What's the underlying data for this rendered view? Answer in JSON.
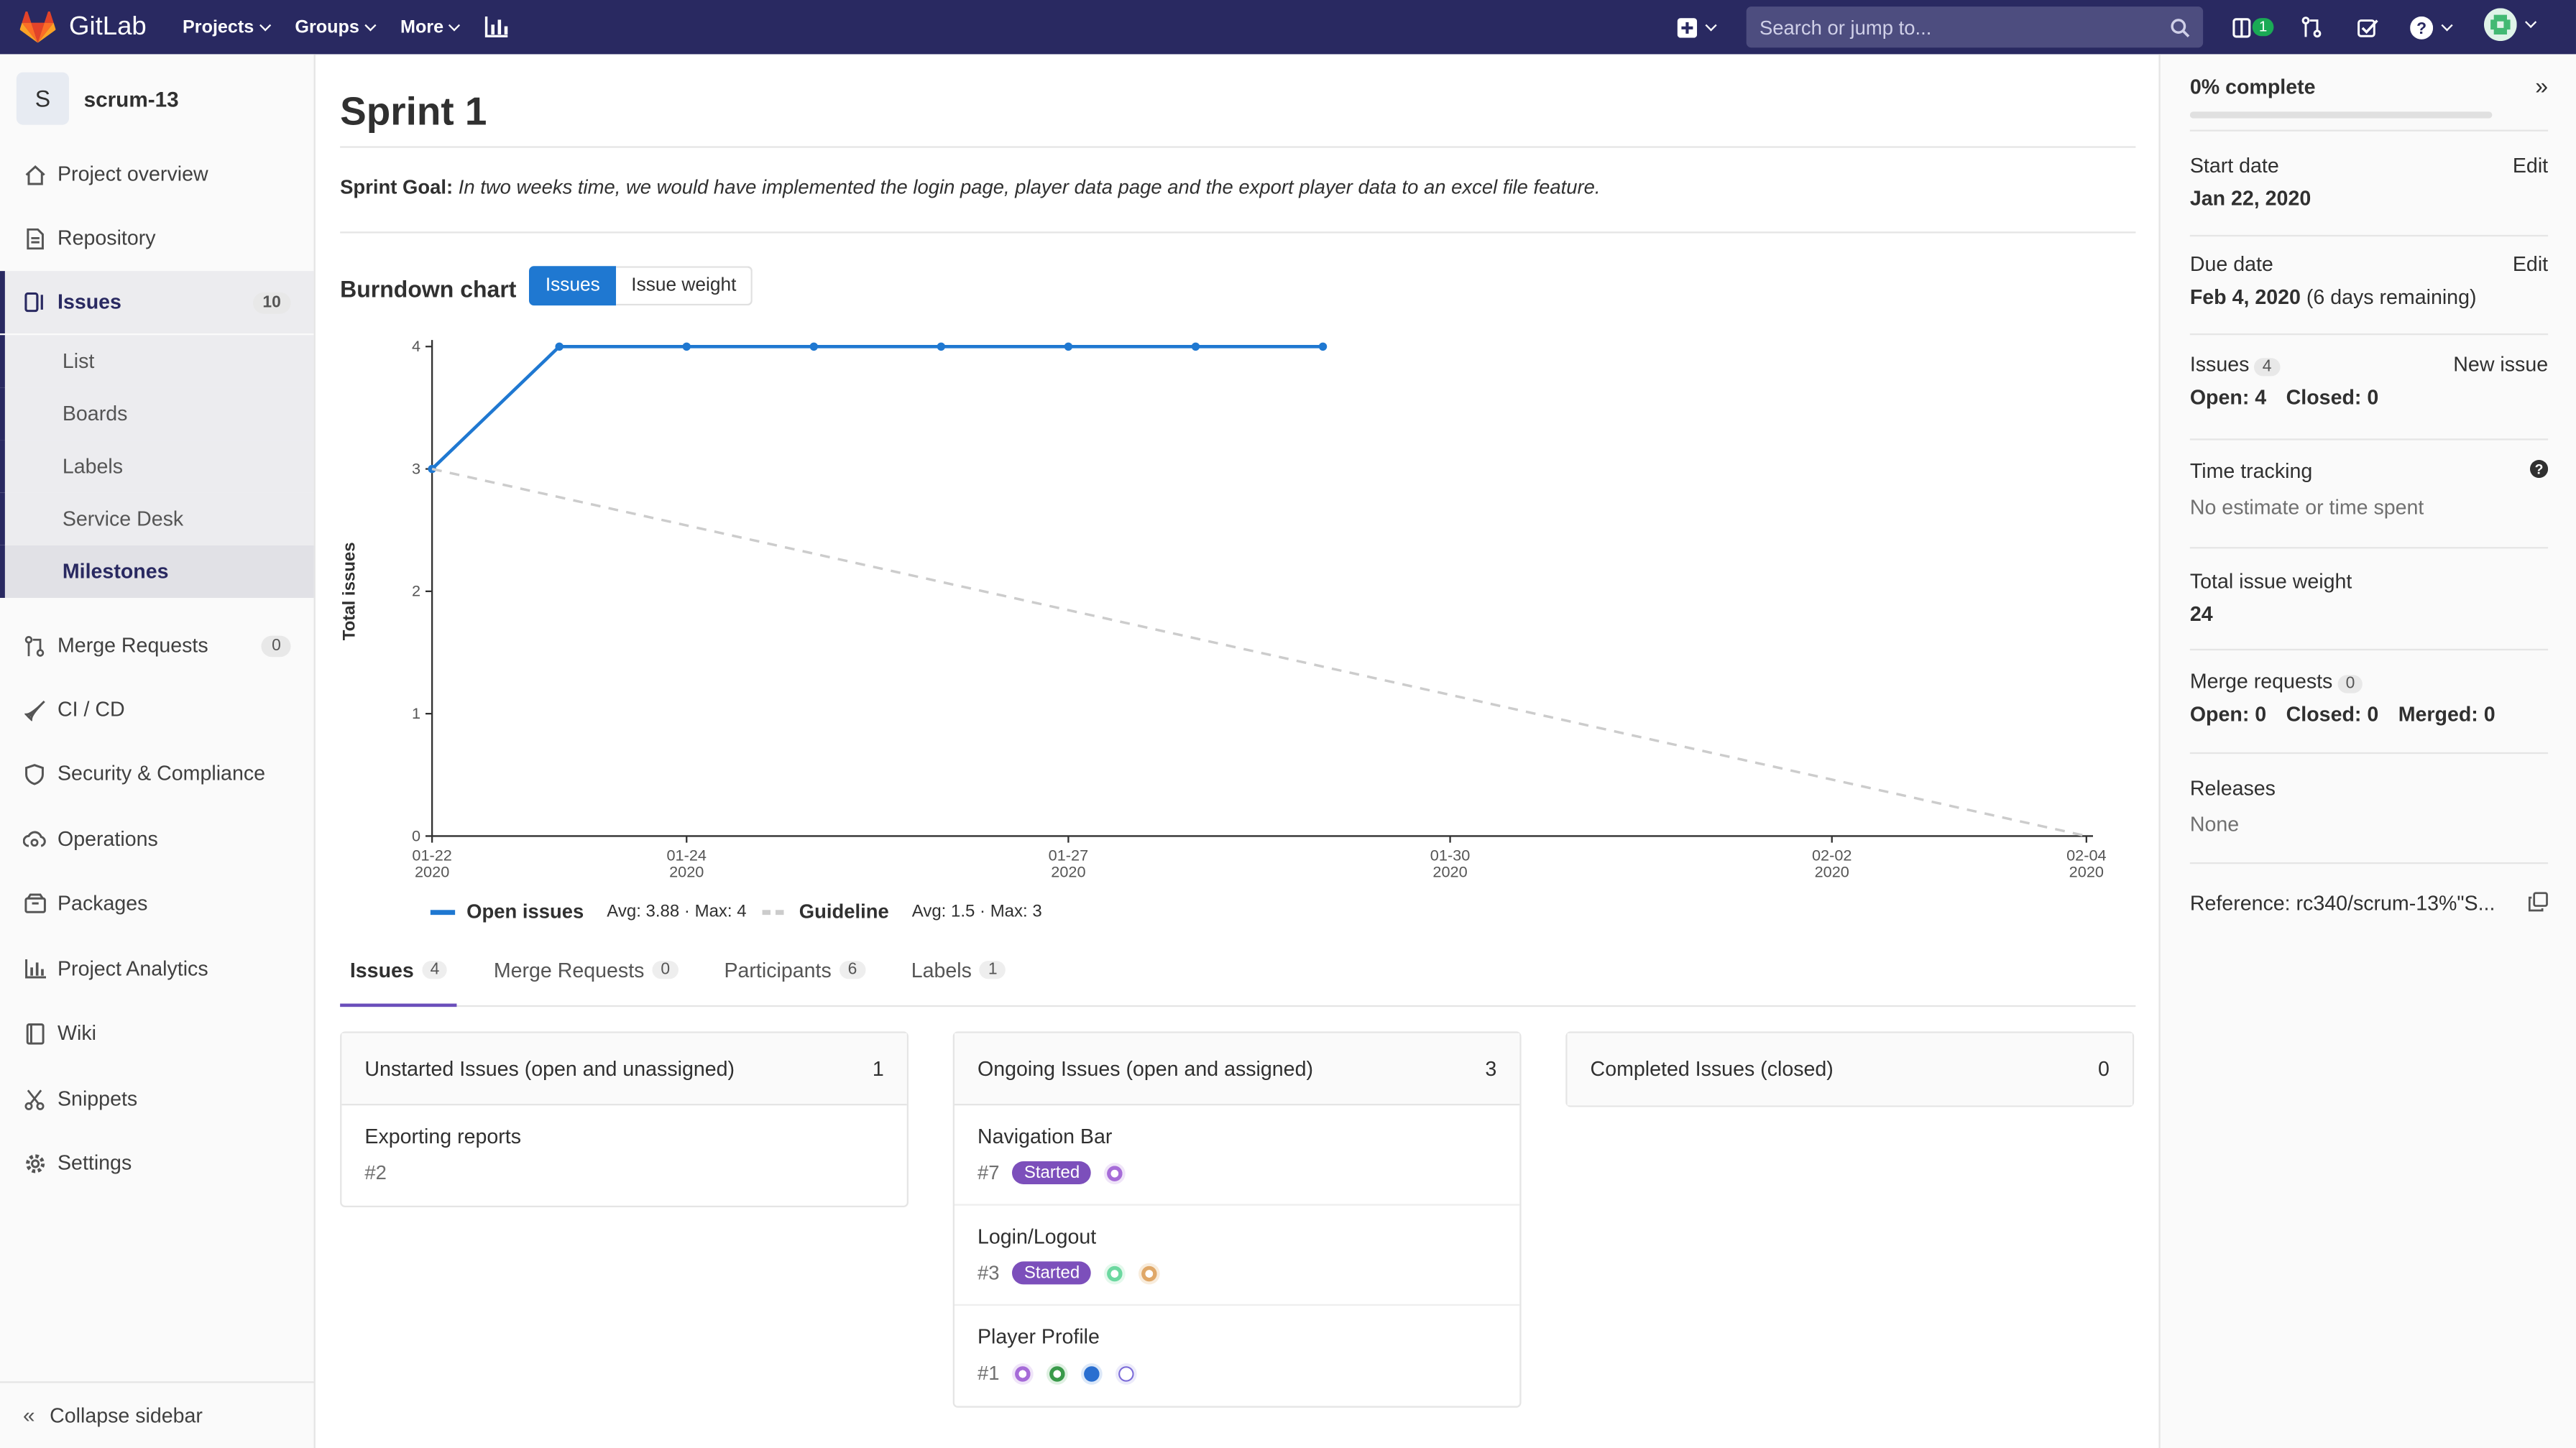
{
  "topnav": {
    "brand": "GitLab",
    "menus": [
      "Projects",
      "Groups",
      "More"
    ],
    "search_placeholder": "Search or jump to...",
    "todo_count": "1"
  },
  "sidebar": {
    "project_letter": "S",
    "project_name": "scrum-13",
    "items": [
      {
        "label": "Project overview",
        "icon": "home-icon"
      },
      {
        "label": "Repository",
        "icon": "doc-icon"
      },
      {
        "label": "Issues",
        "icon": "issues-icon",
        "count": "10"
      },
      {
        "label": "Merge Requests",
        "icon": "merge-request-icon",
        "count": "0"
      },
      {
        "label": "CI / CD",
        "icon": "rocket-icon"
      },
      {
        "label": "Security & Compliance",
        "icon": "shield-icon"
      },
      {
        "label": "Operations",
        "icon": "cloud-gear-icon"
      },
      {
        "label": "Packages",
        "icon": "package-icon"
      },
      {
        "label": "Project Analytics",
        "icon": "chart-icon"
      },
      {
        "label": "Wiki",
        "icon": "book-icon"
      },
      {
        "label": "Snippets",
        "icon": "scissors-icon"
      },
      {
        "label": "Settings",
        "icon": "gear-icon"
      }
    ],
    "issue_subitems": [
      "List",
      "Boards",
      "Labels",
      "Service Desk",
      "Milestones"
    ],
    "collapse_label": "Collapse sidebar"
  },
  "main": {
    "title": "Sprint 1",
    "goal_label": "Sprint Goal:",
    "goal_text": "In two weeks time, we would have implemented the login page, player data page and the export player data to an excel file feature.",
    "burndown_title": "Burndown chart",
    "toggle": {
      "issues": "Issues",
      "weight": "Issue weight"
    },
    "legend": {
      "open_name": "Open issues",
      "open_stats": "Avg: 3.88 · Max: 4",
      "guide_name": "Guideline",
      "guide_stats": "Avg: 1.5 · Max: 3"
    },
    "tabs": [
      {
        "label": "Issues",
        "count": "4"
      },
      {
        "label": "Merge Requests",
        "count": "0"
      },
      {
        "label": "Participants",
        "count": "6"
      },
      {
        "label": "Labels",
        "count": "1"
      }
    ],
    "columns": [
      {
        "title": "Unstarted Issues (open and unassigned)",
        "count": "1"
      },
      {
        "title": "Ongoing Issues (open and assigned)",
        "count": "3"
      },
      {
        "title": "Completed Issues (closed)",
        "count": "0"
      }
    ],
    "unstarted": [
      {
        "title": "Exporting reports",
        "ref": "#2"
      }
    ],
    "ongoing": [
      {
        "title": "Navigation Bar",
        "ref": "#7",
        "label": "Started"
      },
      {
        "title": "Login/Logout",
        "ref": "#3",
        "label": "Started"
      },
      {
        "title": "Player Profile",
        "ref": "#1"
      }
    ]
  },
  "chart_data": {
    "type": "line",
    "ylabel": "Total issues",
    "ylim": [
      0,
      4
    ],
    "yticks": [
      "0",
      "1",
      "2",
      "3",
      "4"
    ],
    "xticks": [
      {
        "date": "01-22",
        "year": "2020",
        "day": 0
      },
      {
        "date": "01-24",
        "year": "2020",
        "day": 2
      },
      {
        "date": "01-27",
        "year": "2020",
        "day": 5
      },
      {
        "date": "01-30",
        "year": "2020",
        "day": 8
      },
      {
        "date": "02-02",
        "year": "2020",
        "day": 11
      },
      {
        "date": "02-04",
        "year": "2020",
        "day": 13
      }
    ],
    "series": [
      {
        "name": "Open issues",
        "color": "#1f78d1",
        "x": [
          0,
          1,
          2,
          3,
          4,
          5,
          6,
          7
        ],
        "values": [
          3,
          4,
          4,
          4,
          4,
          4,
          4,
          4
        ]
      },
      {
        "name": "Guideline",
        "color": "#cccccc",
        "x": [
          0,
          13
        ],
        "values": [
          3,
          0
        ],
        "dashed": true
      }
    ]
  },
  "right_sidebar": {
    "complete": "0% complete",
    "progress": 0,
    "start_label": "Start date",
    "start_value": "Jan 22, 2020",
    "due_label": "Due date",
    "due_value": "Feb 4, 2020",
    "due_remaining": "(6 days remaining)",
    "edit": "Edit",
    "issues_label": "Issues",
    "issues_count": "4",
    "new_issue": "New issue",
    "issues_open": "Open: 4",
    "issues_closed": "Closed: 0",
    "time_label": "Time tracking",
    "time_value": "No estimate or time spent",
    "weight_label": "Total issue weight",
    "weight_value": "24",
    "mr_label": "Merge requests",
    "mr_count": "0",
    "mr_open": "Open: 0",
    "mr_closed": "Closed: 0",
    "mr_merged": "Merged: 0",
    "releases_label": "Releases",
    "releases_value": "None",
    "reference": "Reference: rc340/scrum-13%\"S..."
  }
}
